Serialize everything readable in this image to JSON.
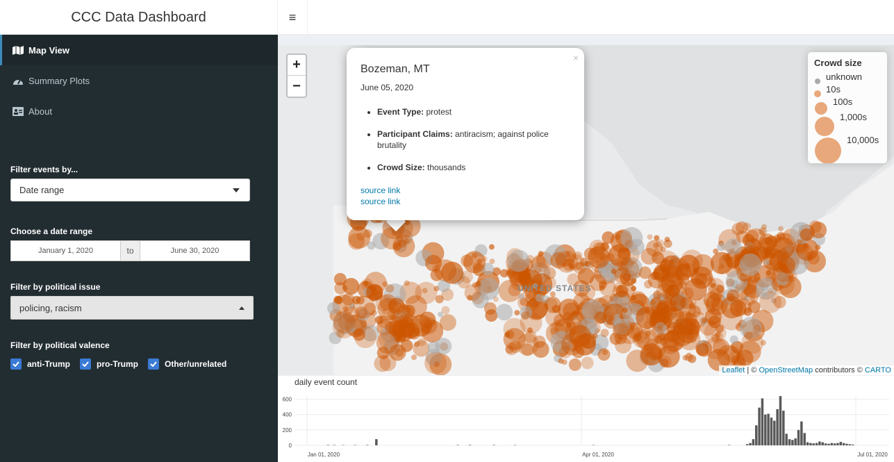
{
  "app": {
    "title": "CCC Data Dashboard",
    "toggle_icon": "hamburger-icon"
  },
  "sidebar": {
    "menu": [
      {
        "label": "Map View",
        "icon": "map-icon",
        "active": true
      },
      {
        "label": "Summary Plots",
        "icon": "dashboard-icon",
        "active": false
      },
      {
        "label": "About",
        "icon": "id-card-icon",
        "active": false
      }
    ],
    "filter_by_label": "Filter events by...",
    "filter_by_value": "Date range",
    "date_range_label": "Choose a date range",
    "date_start": "January 1, 2020",
    "date_sep": "to",
    "date_end": "June 30, 2020",
    "issue_label": "Filter by political issue",
    "issue_value": "policing, racism",
    "valence_label": "Filter by political valence",
    "valence": [
      {
        "label": "anti-Trump",
        "checked": true
      },
      {
        "label": "pro-Trump",
        "checked": true
      },
      {
        "label": "Other/unrelated",
        "checked": true
      }
    ]
  },
  "map": {
    "zoom_in": "+",
    "zoom_out": "−",
    "country_label": "UNITED STATES",
    "legend": {
      "title": "Crowd size",
      "items": [
        "unknown",
        "10s",
        "100s",
        "1,000s",
        "10,000s"
      ],
      "colors": {
        "unknown": "#a9a9a9",
        "crowd": "#cc5500",
        "legend_crowd": "#e8a87c"
      }
    },
    "popup": {
      "close": "×",
      "title": "Bozeman, MT",
      "date": "June 05, 2020",
      "items": [
        {
          "key": "Event Type:",
          "value": " protest"
        },
        {
          "key": "Participant Claims:",
          "value": " antiracism; against police brutality"
        },
        {
          "key": "Crowd Size:",
          "value": " thousands"
        }
      ],
      "links": [
        "source link",
        "source link"
      ]
    },
    "attribution": {
      "leaflet": "Leaflet",
      "sep1": " | © ",
      "osm": "OpenStreetMap",
      "mid": " contributors © ",
      "carto": "CARTO"
    }
  },
  "chart": {
    "title": "daily event count"
  },
  "chart_data": {
    "type": "bar",
    "title": "daily event count",
    "xlabel": "",
    "ylabel": "",
    "ylim": [
      0,
      650
    ],
    "yticks": [
      0,
      200,
      400,
      600
    ],
    "xtick_labels": [
      "Jan 01, 2020",
      "Apr 01, 2020",
      "Jul 01, 2020"
    ],
    "x_range": [
      "2020-01-01",
      "2020-07-01"
    ],
    "points": [
      {
        "x": "2020-01-08",
        "y": 5
      },
      {
        "x": "2020-01-10",
        "y": 5
      },
      {
        "x": "2020-01-13",
        "y": 4
      },
      {
        "x": "2020-01-17",
        "y": 4
      },
      {
        "x": "2020-01-21",
        "y": 5
      },
      {
        "x": "2020-01-24",
        "y": 80
      },
      {
        "x": "2020-02-20",
        "y": 5
      },
      {
        "x": "2020-02-24",
        "y": 6
      },
      {
        "x": "2020-03-03",
        "y": 5
      },
      {
        "x": "2020-03-10",
        "y": 4
      },
      {
        "x": "2020-04-05",
        "y": 4
      },
      {
        "x": "2020-05-20",
        "y": 5
      },
      {
        "x": "2020-05-26",
        "y": 15
      },
      {
        "x": "2020-05-27",
        "y": 30
      },
      {
        "x": "2020-05-28",
        "y": 80
      },
      {
        "x": "2020-05-29",
        "y": 260
      },
      {
        "x": "2020-05-30",
        "y": 490
      },
      {
        "x": "2020-05-31",
        "y": 610
      },
      {
        "x": "2020-06-01",
        "y": 400
      },
      {
        "x": "2020-06-02",
        "y": 410
      },
      {
        "x": "2020-06-03",
        "y": 360
      },
      {
        "x": "2020-06-04",
        "y": 320
      },
      {
        "x": "2020-06-05",
        "y": 470
      },
      {
        "x": "2020-06-06",
        "y": 640
      },
      {
        "x": "2020-06-07",
        "y": 450
      },
      {
        "x": "2020-06-08",
        "y": 150
      },
      {
        "x": "2020-06-09",
        "y": 80
      },
      {
        "x": "2020-06-10",
        "y": 70
      },
      {
        "x": "2020-06-11",
        "y": 90
      },
      {
        "x": "2020-06-12",
        "y": 200
      },
      {
        "x": "2020-06-13",
        "y": 310
      },
      {
        "x": "2020-06-14",
        "y": 160
      },
      {
        "x": "2020-06-15",
        "y": 40
      },
      {
        "x": "2020-06-16",
        "y": 30
      },
      {
        "x": "2020-06-17",
        "y": 25
      },
      {
        "x": "2020-06-18",
        "y": 30
      },
      {
        "x": "2020-06-19",
        "y": 50
      },
      {
        "x": "2020-06-20",
        "y": 40
      },
      {
        "x": "2020-06-21",
        "y": 25
      },
      {
        "x": "2020-06-22",
        "y": 20
      },
      {
        "x": "2020-06-23",
        "y": 30
      },
      {
        "x": "2020-06-24",
        "y": 25
      },
      {
        "x": "2020-06-25",
        "y": 30
      },
      {
        "x": "2020-06-26",
        "y": 45
      },
      {
        "x": "2020-06-27",
        "y": 30
      },
      {
        "x": "2020-06-28",
        "y": 20
      },
      {
        "x": "2020-06-29",
        "y": 15
      },
      {
        "x": "2020-06-30",
        "y": 10
      }
    ]
  }
}
